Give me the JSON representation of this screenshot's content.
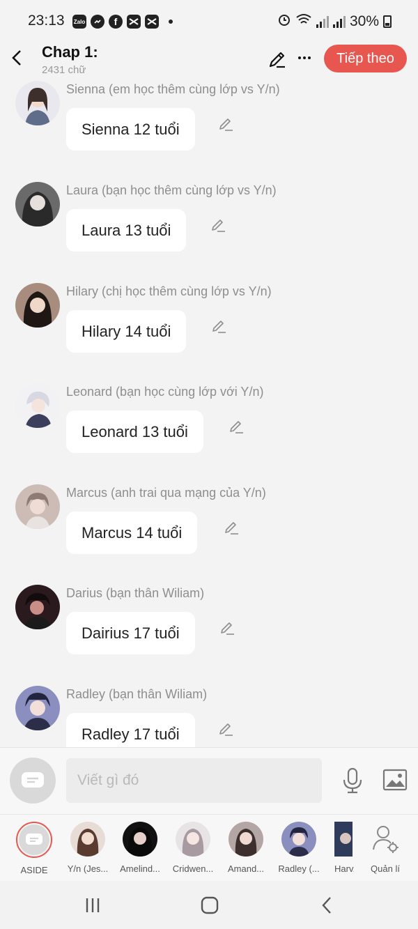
{
  "status_bar": {
    "time": "23:13",
    "app_icons": [
      "Zalo",
      "messenger-icon",
      "facebook-icon",
      "capcut-icon",
      "capcut-icon"
    ],
    "battery": "30%"
  },
  "header": {
    "title": "Chap 1:",
    "word_count": "2431 chữ",
    "next_label": "Tiếp theo"
  },
  "messages": [
    {
      "sender": "Sienna (em học thêm cùng lớp vs Y/n)",
      "text": "Sienna 12 tuổi",
      "avatar_color": "#cfcfd6"
    },
    {
      "sender": "Laura (bạn học thêm cùng lớp vs Y/n)",
      "text": "Laura 13 tuổi",
      "avatar_color": "#4a4a4a"
    },
    {
      "sender": "Hilary (chị học thêm cùng lớp vs Y/n)",
      "text": "Hilary 14 tuổi",
      "avatar_color": "#6b4a3a"
    },
    {
      "sender": "Leonard (bạn học cùng lớp với Y/n)",
      "text": "Leonard 13 tuổi",
      "avatar_color": "#c9c6cf"
    },
    {
      "sender": "Marcus (anh trai qua mạng của Y/n)",
      "text": "Marcus 14 tuổi",
      "avatar_color": "#b8a69e"
    },
    {
      "sender": "Darius (bạn thân Wiliam)",
      "text": "Dairius 17 tuổi",
      "avatar_color": "#3a2226"
    },
    {
      "sender": "Radley (bạn thân Wiliam)",
      "text": "Radley 17 tuổi",
      "avatar_color": "#5b5d86"
    }
  ],
  "composer": {
    "placeholder": "Viết gì đó"
  },
  "characters": [
    {
      "label": "ASIDE"
    },
    {
      "label": "Y/n (Jes...",
      "avatar_color": "#c9a896"
    },
    {
      "label": "Amelind...",
      "avatar_color": "#1d1d1d"
    },
    {
      "label": "Cridwen...",
      "avatar_color": "#b9b2b4"
    },
    {
      "label": "Amand...",
      "avatar_color": "#7a6a68"
    },
    {
      "label": "Radley (...",
      "avatar_color": "#5b5d86"
    },
    {
      "label": "Harv...",
      "avatar_color": "#2f3b5a"
    },
    {
      "label": "Quản lí"
    }
  ]
}
